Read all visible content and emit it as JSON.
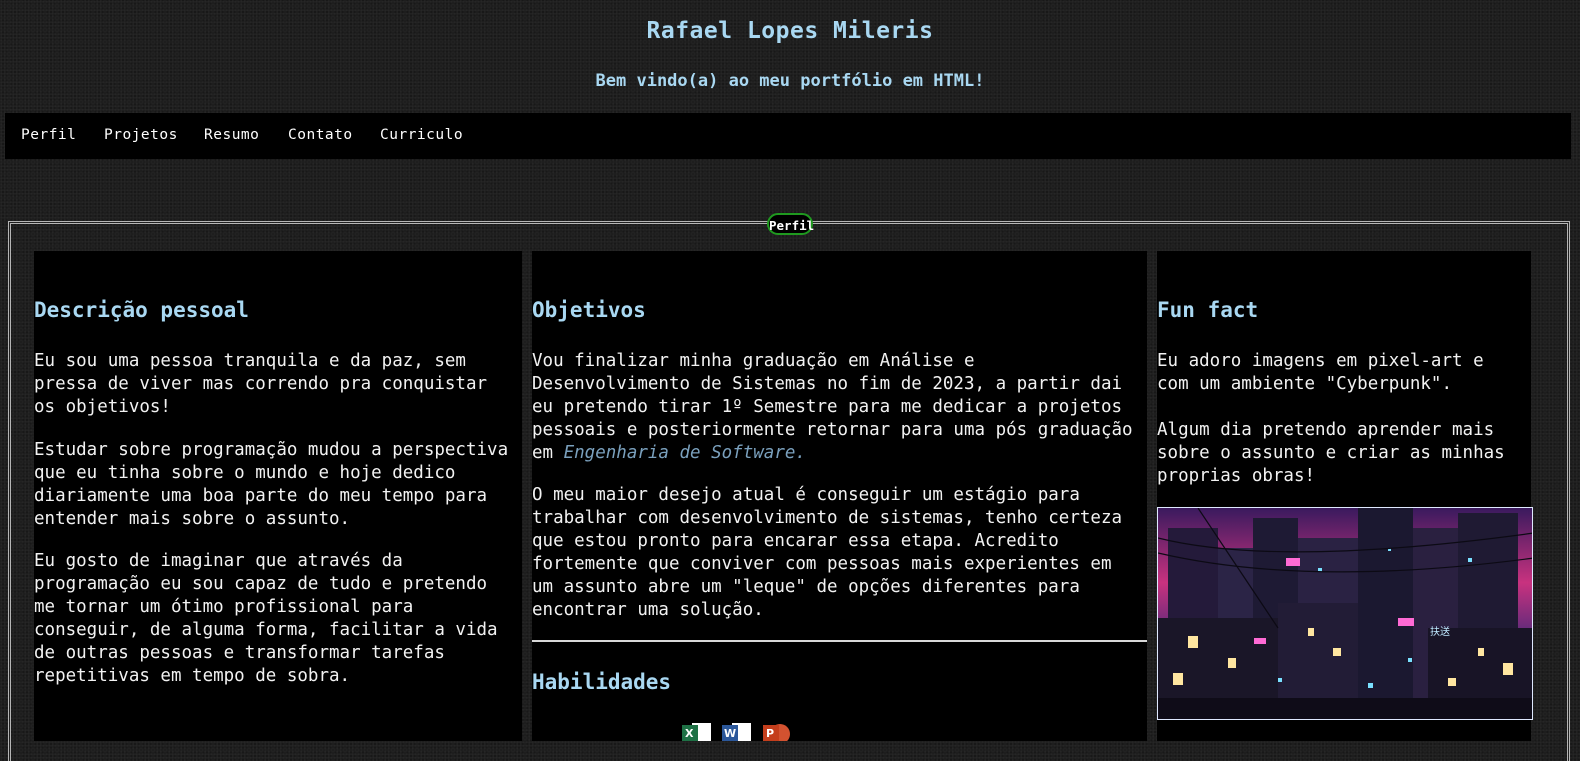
{
  "header": {
    "title": "Rafael Lopes Mileris",
    "subtitle": "Bem vindo(a) ao meu portfólio em HTML!"
  },
  "nav": {
    "items": [
      "Perfil",
      "Projetos",
      "Resumo",
      "Contato",
      "Curriculo"
    ]
  },
  "section": {
    "legend": "Perfil"
  },
  "descricao": {
    "heading": "Descrição pessoal",
    "p1": "Eu sou uma pessoa tranquila e da paz, sem\npressa de viver mas correndo pra conquistar\nos objetivos!",
    "p2": "Estudar sobre programação mudou a perspectiva\nque eu tinha sobre o mundo e hoje dedico\ndiariamente uma boa parte do meu tempo para\nentender mais sobre o assunto.",
    "p3": "Eu gosto de imaginar que através da\nprogramação eu sou capaz de tudo e pretendo\nme tornar um ótimo profissional para\nconseguir, de alguma forma, facilitar a vida\nde outras pessoas e transformar tarefas\nrepetitivas em tempo de sobra."
  },
  "objetivos": {
    "heading": "Objetivos",
    "p1": "Vou finalizar minha graduação em Análise e\nDesenvolvimento de Sistemas no fim de 2023, a partir dai\neu pretendo tirar 1º Semestre para me dedicar a projetos\npessoais e posteriormente retornar para uma pós graduação\nem ",
    "p1_link": "Engenharia de Software",
    "p1_end": ".",
    "p2": "O meu maior desejo atual é conseguir um estágio para\ntrabalhar com desenvolvimento de sistemas, tenho certeza\nque estou pronto para encarar essa etapa. Acredito\nfortemente que conviver com pessoas mais experientes em\num assunto abre um \"leque\" de opções diferentes para\nencontrar uma solução."
  },
  "habilidades": {
    "heading": "Habilidades",
    "icons": [
      "excel-icon",
      "word-icon",
      "powerpoint-icon"
    ]
  },
  "funfact": {
    "heading": "Fun fact",
    "p1": "Eu adoro imagens em pixel-art e\ncom um ambiente \"Cyberpunk\".",
    "p2": "Algum dia pretendo aprender mais\nsobre o assunto e criar as minhas\nproprias obras!",
    "image_sign_1": "扶送"
  },
  "colors": {
    "accent": "#a9d8f2",
    "legend_border": "#1f9a1f",
    "link": "#7aa0bd"
  }
}
